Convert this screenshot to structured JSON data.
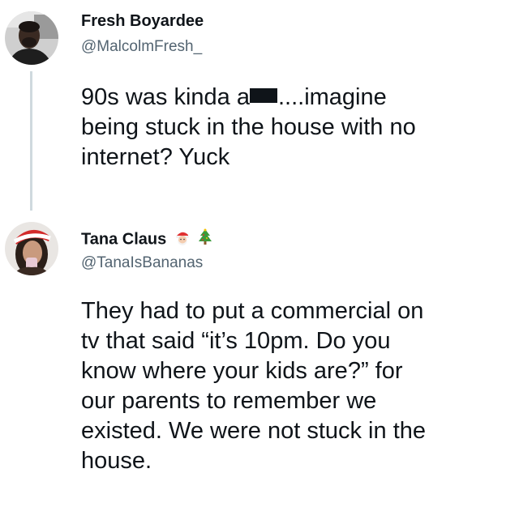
{
  "tweets": [
    {
      "display_name": "Fresh Boyardee",
      "handle": "@MalcolmFresh_",
      "avatar_icon": "profile-photo-man",
      "text_parts": {
        "before_redaction": "90s was kinda a",
        "after_redaction": "....imagine"
      },
      "text_lines": [
        "being stuck in the house with no",
        "internet? Yuck"
      ]
    },
    {
      "display_name": "Tana Claus",
      "handle": "@TanaIsBananas",
      "avatar_icon": "profile-photo-woman-santa-hat",
      "name_emojis": [
        "santa-face-emoji",
        "christmas-tree-emoji"
      ],
      "text_lines": [
        "They had to put a commercial on",
        "tv that said “it’s 10pm. Do you",
        "know where your kids are?” for",
        "our parents to remember we",
        "existed. We were not stuck in the",
        "house."
      ]
    }
  ],
  "colors": {
    "text": "#0f1419",
    "secondary_text": "#536471",
    "thread_line": "#cfd9de",
    "background": "#ffffff"
  }
}
